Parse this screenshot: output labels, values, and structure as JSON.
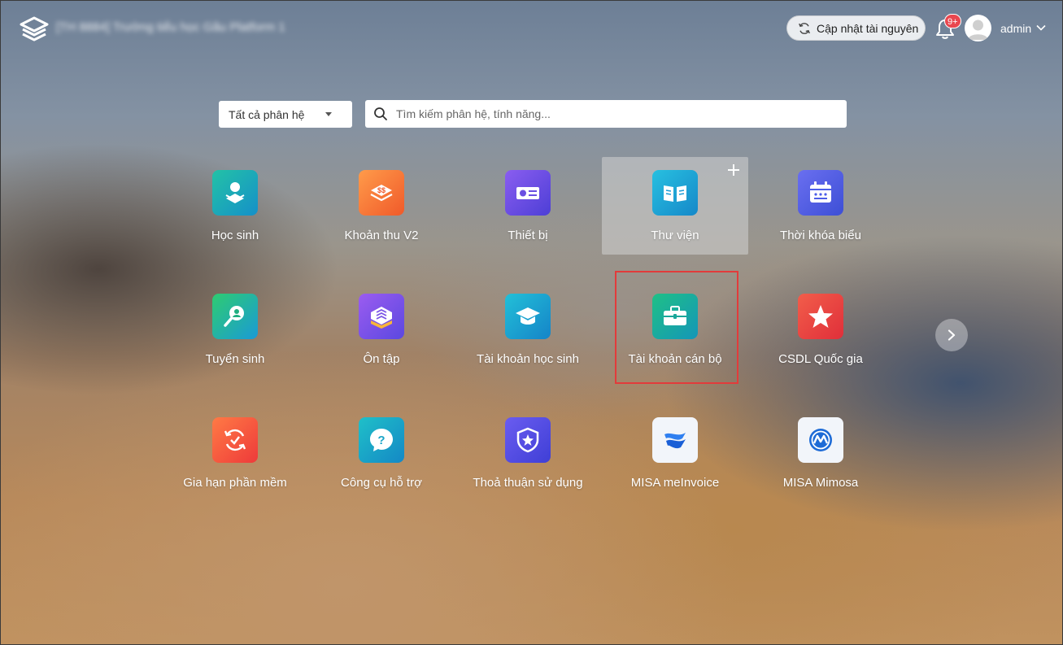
{
  "header": {
    "school_name": "[TH 8884] Trường tiểu học Gãu Platform 1",
    "update_button": "Cập nhật tài nguyên",
    "notification_badge": "9+",
    "user_name": "admin"
  },
  "search": {
    "module_select": "Tất cả phân hệ",
    "placeholder": "Tìm kiếm phân hệ, tính năng..."
  },
  "apps": [
    {
      "label": "Học sinh",
      "icon": "student-icon",
      "color": "#18b5a0"
    },
    {
      "label": "Khoản thu V2",
      "icon": "fee-icon",
      "color": "#f47b3b"
    },
    {
      "label": "Thiết bị",
      "icon": "projector-icon",
      "color": "#6d4fe0"
    },
    {
      "label": "Thư viện",
      "icon": "book-icon",
      "color": "#1aa6d8"
    },
    {
      "label": "Thời khóa biểu",
      "icon": "calendar-icon",
      "color": "#4f5ee8"
    },
    {
      "label": "Tuyển sinh",
      "icon": "search-person-icon",
      "color": "#21b36b"
    },
    {
      "label": "Ôn tập",
      "icon": "review-icon",
      "color": "#7b55e6"
    },
    {
      "label": "Tài khoản học sinh",
      "icon": "graduation-cap-icon",
      "color": "#1ca3cf"
    },
    {
      "label": "Tài khoản cán bộ",
      "icon": "briefcase-icon",
      "color": "#14b08c"
    },
    {
      "label": "CSDL Quốc gia",
      "icon": "star-icon",
      "color": "#ec3b3b"
    },
    {
      "label": "Gia hạn phần mềm",
      "icon": "renew-icon",
      "color": "#f25a3a"
    },
    {
      "label": "Công cụ hỗ trợ",
      "icon": "help-icon",
      "color": "#1aa5c8"
    },
    {
      "label": "Thoả thuận sử dụng",
      "icon": "shield-icon",
      "color": "#5b4fe6"
    },
    {
      "label": "MISA meInvoice",
      "icon": "meinvoice-icon",
      "color": "#eef2f8"
    },
    {
      "label": "MISA Mimosa",
      "icon": "mimosa-icon",
      "color": "#eef2f8"
    }
  ]
}
